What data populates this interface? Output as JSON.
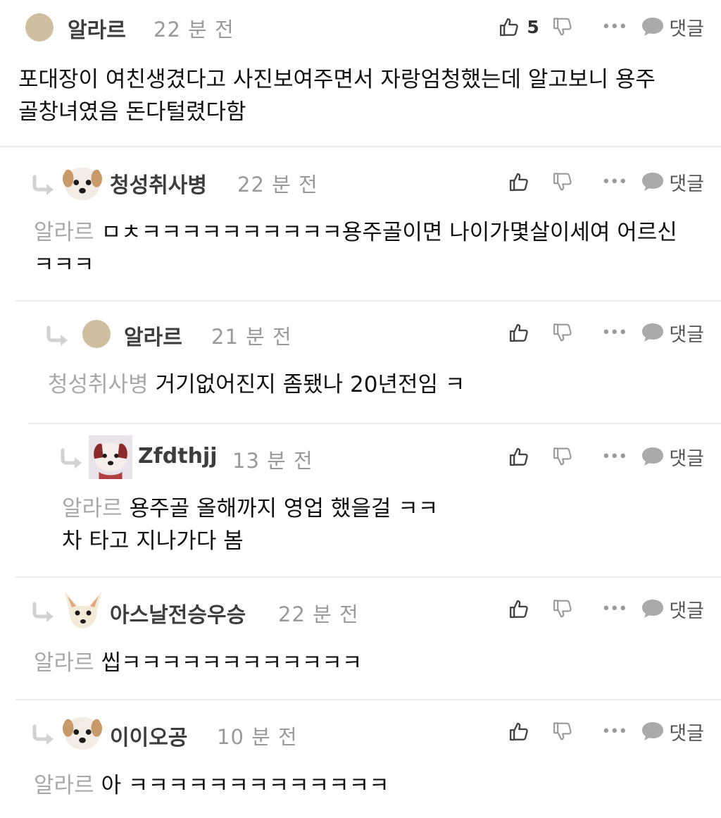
{
  "reply_label": "댓글",
  "more_label": "•••",
  "comments": [
    {
      "username": "알라르",
      "time": "22 분 전",
      "likes": "5",
      "mention": "",
      "text": "포대장이 여친생겼다고 사진보여주면서 자랑엄청했는데 알고보니 용주\n골창녀였음 돈다털렸다함"
    },
    {
      "username": "청성취사병",
      "time": "22 분 전",
      "mention": "알라르",
      "text": "ㅁㅊㅋㅋㅋㅋㅋㅋㅋㅋㅋㅋ용주골이면 나이가몇살이세여 어르신\nㅋㅋㅋ"
    },
    {
      "username": "알라르",
      "time": "21 분 전",
      "mention": "청성취사병",
      "text": "거기없어진지 좀됐나 20년전임 ㅋ"
    },
    {
      "username": "Zfdthjj",
      "time": "13 분 전",
      "mention": "알라르",
      "text": "용주골 올해까지 영업 했을걸 ㅋㅋ\n차 타고 지나가다 봄"
    },
    {
      "username": "아스날전승우승",
      "time": "22 분 전",
      "mention": "알라르",
      "text": "씹ㅋㅋㅋㅋㅋㅋㅋㅋㅋㅋㅋㅋ"
    },
    {
      "username": "이이오공",
      "time": "10 분 전",
      "mention": "알라르",
      "text": "아 ㅋㅋㅋㅋㅋㅋㅋㅋㅋㅋㅋㅋㅋ"
    }
  ],
  "colors": {
    "username": "#3d3d3d",
    "time": "#9a9a9a",
    "mention": "#a8a8a8",
    "divider": "#ececec",
    "icon": "#555555"
  },
  "icons": {
    "like": "thumbs-up-icon",
    "dislike": "thumbs-down-icon",
    "more": "more-dots-icon",
    "reply": "speech-bubble-icon",
    "indent": "reply-arrow-icon"
  }
}
